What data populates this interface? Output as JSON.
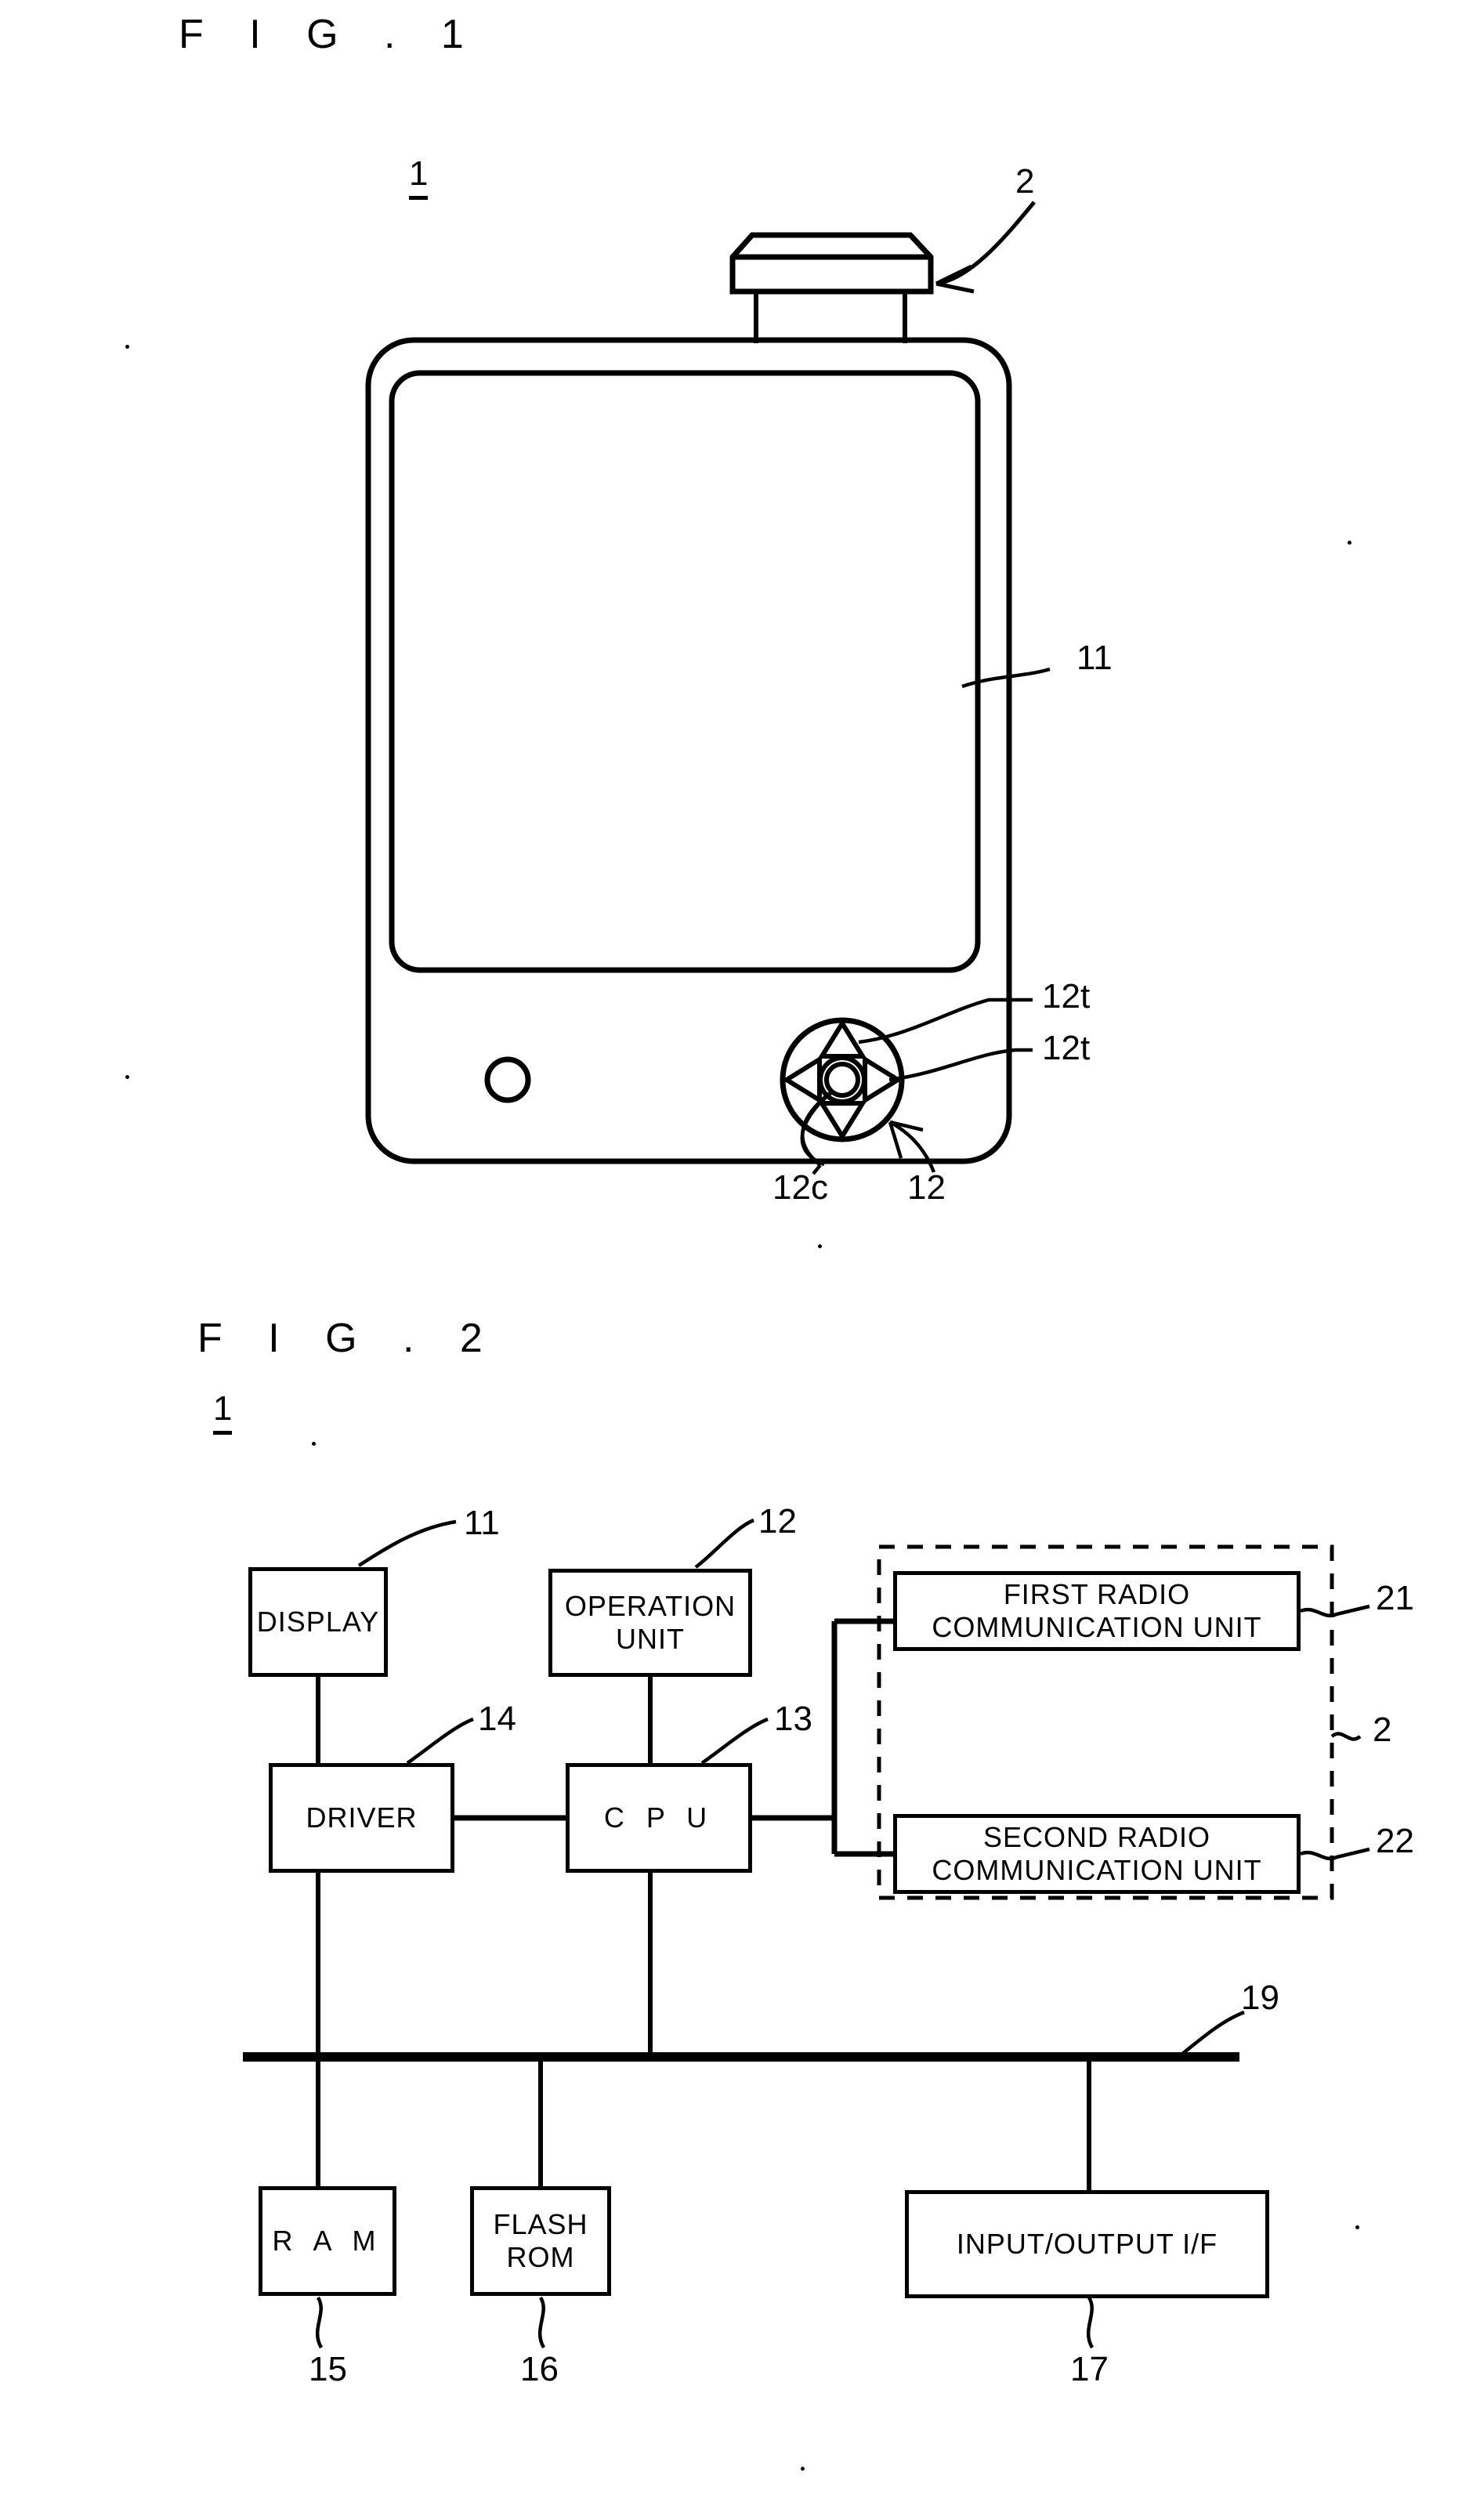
{
  "figures": [
    {
      "id": "fig1",
      "title": "F I G . 1",
      "device_ref": "1",
      "callouts": {
        "antenna": "2",
        "display": "11",
        "dpad_key_top": "12t",
        "dpad_key_right": "12t",
        "dpad_center": "12c",
        "operation_unit": "12"
      }
    },
    {
      "id": "fig2",
      "title": "F I G . 2",
      "device_ref": "1",
      "blocks": [
        {
          "key": "display",
          "label": "DISPLAY",
          "ref": "11"
        },
        {
          "key": "operation_unit",
          "label": "OPERATION\nUNIT",
          "ref": "12"
        },
        {
          "key": "first_radio",
          "label": "FIRST RADIO\nCOMMUNICATION UNIT",
          "ref": "21"
        },
        {
          "key": "second_radio",
          "label": "SECOND RADIO\nCOMMUNICATION UNIT",
          "ref": "22"
        },
        {
          "key": "driver",
          "label": "DRIVER",
          "ref": "14"
        },
        {
          "key": "cpu",
          "label": "C P U",
          "ref": "13"
        },
        {
          "key": "ram",
          "label": "R A M",
          "ref": "15"
        },
        {
          "key": "flash_rom",
          "label": "FLASH\nROM",
          "ref": "16"
        },
        {
          "key": "io_if",
          "label": "INPUT/OUTPUT I/F",
          "ref": "17"
        }
      ],
      "groups": [
        {
          "key": "radio_module",
          "label": "",
          "ref": "2"
        }
      ],
      "bus": {
        "label": "",
        "ref": "19"
      }
    }
  ],
  "labels": {
    "fig1_title": "F I G . 1",
    "fig2_title": "F I G . 2",
    "ref_1_fig1": "1",
    "ref_1_fig2": "1",
    "ref_2_fig1": "2",
    "ref_11_fig1": "11",
    "ref_12t_a": "12t",
    "ref_12t_b": "12t",
    "ref_12c": "12c",
    "ref_12_fig1": "12",
    "block_display": "DISPLAY",
    "block_operation_unit_line1": "OPERATION",
    "block_operation_unit_line2": "UNIT",
    "block_first_radio_line1": "FIRST RADIO",
    "block_first_radio_line2": "COMMUNICATION UNIT",
    "block_second_radio_line1": "SECOND RADIO",
    "block_second_radio_line2": "COMMUNICATION UNIT",
    "block_driver": "DRIVER",
    "block_cpu": "C P U",
    "block_ram": "R A M",
    "block_flash_line1": "FLASH",
    "block_flash_line2": "ROM",
    "block_io_if": "INPUT/OUTPUT I/F",
    "ref_11_fig2": "11",
    "ref_12_fig2": "12",
    "ref_13": "13",
    "ref_14": "14",
    "ref_15": "15",
    "ref_16": "16",
    "ref_17": "17",
    "ref_19": "19",
    "ref_21": "21",
    "ref_22": "22",
    "ref_2_fig2": "2"
  },
  "colors": {
    "ink": "#000000",
    "paper": "#ffffff"
  }
}
